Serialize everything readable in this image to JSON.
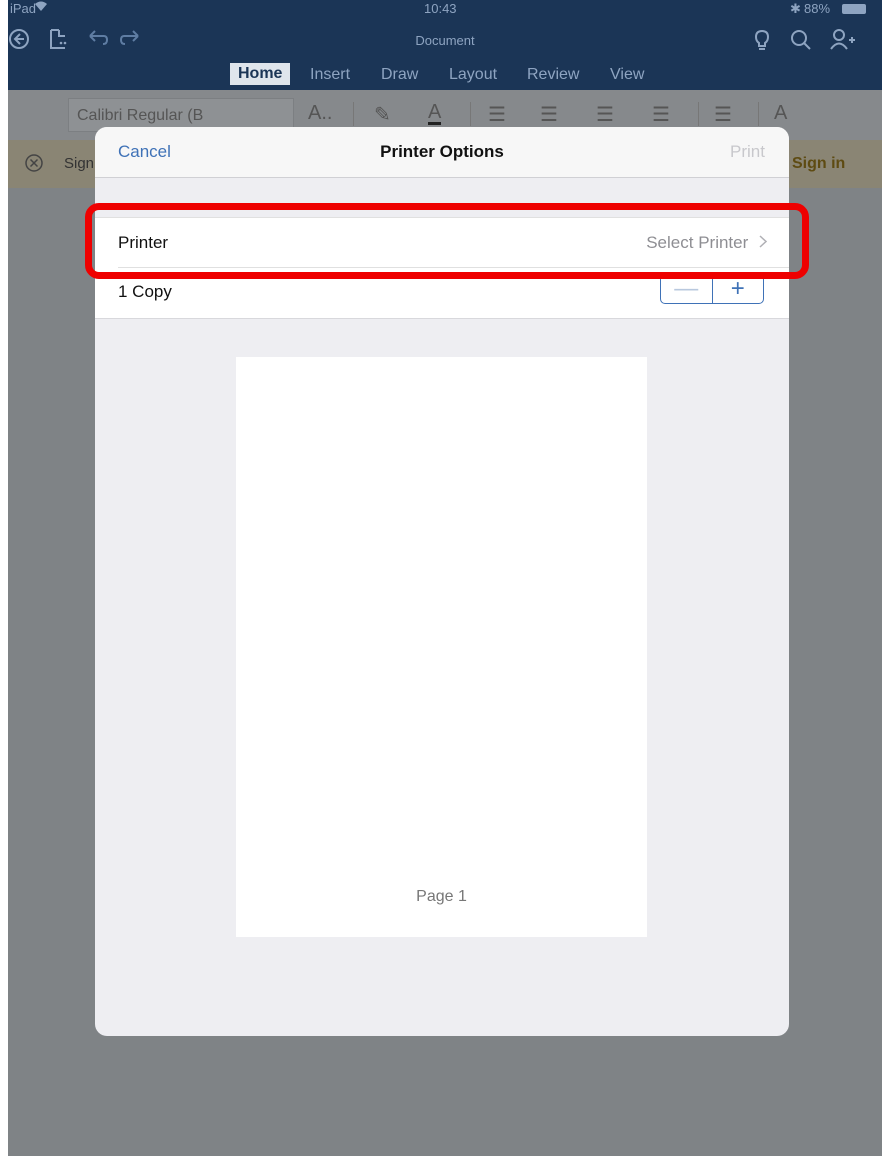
{
  "status_bar": {
    "device": "iPad",
    "time": "10:43",
    "battery": "88%"
  },
  "title_bar": {
    "document_title": "Document",
    "icons": [
      "back-icon",
      "file-icon",
      "undo-icon",
      "redo-icon",
      "lightbulb-icon",
      "search-icon",
      "share-person-icon"
    ]
  },
  "tabs": [
    {
      "label": "Home",
      "active": true
    },
    {
      "label": "Insert"
    },
    {
      "label": "Draw"
    },
    {
      "label": "Layout"
    },
    {
      "label": "Review"
    },
    {
      "label": "View"
    }
  ],
  "ribbon": {
    "font_name": "Calibri Regular (B"
  },
  "banner": {
    "text": "Sign",
    "sign_in": "Sign in"
  },
  "modal": {
    "cancel": "Cancel",
    "title": "Printer Options",
    "print": "Print",
    "printer_label": "Printer",
    "printer_value": "Select Printer",
    "copy_label": "1 Copy",
    "minus": "—",
    "plus": "+",
    "page_label": "Page 1"
  },
  "colors": {
    "accent": "#3f72b7",
    "header_bg": "#1b3556",
    "highlight": "#ee0000"
  }
}
